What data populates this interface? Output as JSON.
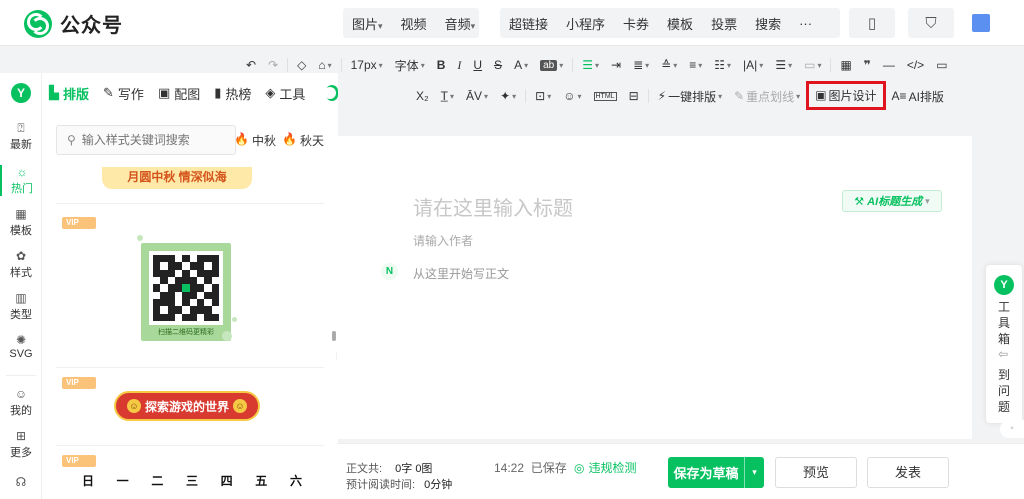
{
  "header": {
    "app_name": "公众号",
    "nav_group_1": [
      {
        "label": "图片",
        "caret": "▾"
      },
      {
        "label": "视频",
        "caret": ""
      },
      {
        "label": "音频",
        "caret": "▾"
      }
    ],
    "nav_group_2": [
      "超链接",
      "小程序",
      "卡券",
      "模板",
      "投票",
      "搜索",
      "···"
    ],
    "icons": [
      "phone-preview-icon",
      "shield-icon",
      "avatar-icon"
    ]
  },
  "toolbar_row1": {
    "undo": "↶",
    "redo": "↷",
    "font_size": "17px",
    "font_family": "字体",
    "bold": "B",
    "italic": "I",
    "underline": "U",
    "strike": "S",
    "font_color": "A",
    "bg_color": "ab"
  },
  "toolbar_row2": {
    "subscript": "X₂",
    "one_click_layout": "一键排版",
    "highlight_line": "重点划线",
    "picture_design": "图片设计",
    "ai_layout": "AI排版"
  },
  "sidebar": {
    "logo": "Y",
    "items": [
      {
        "icon": "⍰",
        "label": "最新"
      },
      {
        "icon": "☼",
        "label": "热门",
        "active": true
      },
      {
        "icon": "▦",
        "label": "模板"
      },
      {
        "icon": "✿",
        "label": "样式"
      },
      {
        "icon": "▥",
        "label": "类型"
      },
      {
        "icon": "✺",
        "label": "SVG"
      },
      {
        "icon": "☺",
        "label": "我的"
      },
      {
        "icon": "⊞",
        "label": "更多"
      },
      {
        "icon": "☊",
        "label": ""
      }
    ]
  },
  "panel": {
    "tabs": [
      {
        "icon": "▙",
        "label": "排版",
        "active": true
      },
      {
        "icon": "✎",
        "label": "写作"
      },
      {
        "icon": "▣",
        "label": "配图"
      },
      {
        "icon": "▮",
        "label": "热榜"
      },
      {
        "icon": "◈",
        "label": "工具"
      }
    ],
    "search_placeholder": "输入样式关键词搜索",
    "hot_tags": [
      "中秋",
      "秋天"
    ],
    "banner_text": "月圆中秋 情深似海",
    "vip_label": "VIP",
    "qr_caption": "扫描二维码更精彩",
    "qr_center": "微信",
    "game_banner": "探索游戏的世界",
    "weekdays": [
      "日",
      "一",
      "二",
      "三",
      "四",
      "五",
      "六"
    ]
  },
  "editor": {
    "title_placeholder": "请在这里输入标题",
    "ai_title_button": "AI标题生成",
    "author_placeholder": "请输入作者",
    "body_placeholder": "从这里开始写正文"
  },
  "toolbox": {
    "label_chars": [
      "工",
      "具",
      "箱"
    ],
    "tail_chars": [
      "到",
      "问",
      "题"
    ]
  },
  "footer": {
    "body_count_label": "正文共:",
    "word_count": "0字",
    "image_count": "0图",
    "read_time_label": "预计阅读时间:",
    "read_time": "0分钟",
    "saved_time": "14:22",
    "saved_text": "已保存",
    "compliance_check": "违规检测",
    "save_draft": "保存为草稿",
    "preview": "预览",
    "publish": "发表"
  },
  "colors": {
    "brand_green": "#07c160",
    "highlight_red": "#e0141e"
  }
}
